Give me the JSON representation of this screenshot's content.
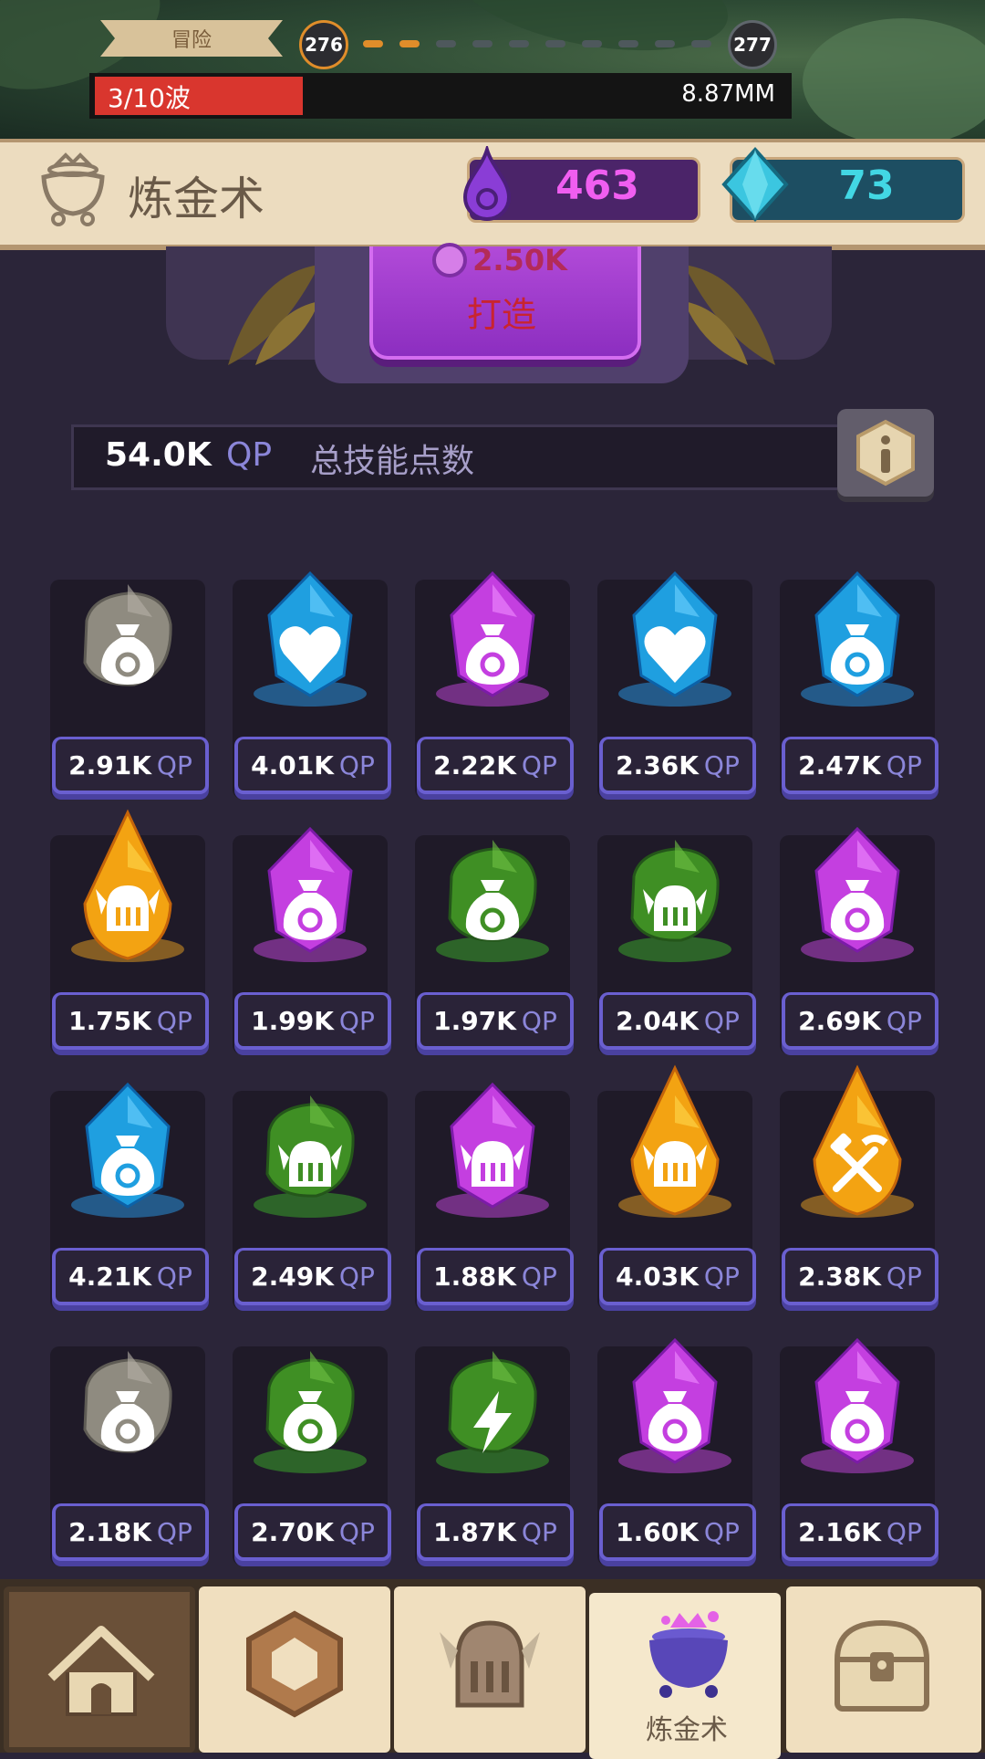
{
  "top": {
    "mode_label": "冒险",
    "level_current": "276",
    "level_next": "277",
    "wave_text": "3/10波",
    "wave_progress": 0.3,
    "damage_text": "8.87MM"
  },
  "header": {
    "title": "炼金术",
    "elixir_value": "463",
    "gem_value": "73",
    "colors": {
      "elixir": "#f05ef0",
      "gem": "#42d7e4"
    }
  },
  "forge": {
    "cost": "2.50K",
    "label": "打造"
  },
  "qp": {
    "value": "54.0K",
    "unit": "QP",
    "label": "总技能点数"
  },
  "grid": [
    {
      "qp": "2.91K",
      "unit": "QP",
      "gem": "grey",
      "icon": "money-bag-icon"
    },
    {
      "qp": "4.01K",
      "unit": "QP",
      "gem": "blue",
      "icon": "heart-icon"
    },
    {
      "qp": "2.22K",
      "unit": "QP",
      "gem": "purple",
      "icon": "money-bag-icon"
    },
    {
      "qp": "2.36K",
      "unit": "QP",
      "gem": "blue",
      "icon": "heart-icon"
    },
    {
      "qp": "2.47K",
      "unit": "QP",
      "gem": "blue",
      "icon": "money-bag-icon"
    },
    {
      "qp": "1.75K",
      "unit": "QP",
      "gem": "gold",
      "icon": "knight-helmet-icon"
    },
    {
      "qp": "1.99K",
      "unit": "QP",
      "gem": "purple",
      "icon": "money-bag-icon"
    },
    {
      "qp": "1.97K",
      "unit": "QP",
      "gem": "green",
      "icon": "money-bag-icon"
    },
    {
      "qp": "2.04K",
      "unit": "QP",
      "gem": "green",
      "icon": "knight-helmet-icon"
    },
    {
      "qp": "2.69K",
      "unit": "QP",
      "gem": "purple",
      "icon": "money-bag-icon"
    },
    {
      "qp": "4.21K",
      "unit": "QP",
      "gem": "blue",
      "icon": "money-bag-icon"
    },
    {
      "qp": "2.49K",
      "unit": "QP",
      "gem": "green",
      "icon": "knight-helmet-icon"
    },
    {
      "qp": "1.88K",
      "unit": "QP",
      "gem": "purple",
      "icon": "knight-helmet-icon"
    },
    {
      "qp": "4.03K",
      "unit": "QP",
      "gem": "gold",
      "icon": "knight-helmet-icon"
    },
    {
      "qp": "2.38K",
      "unit": "QP",
      "gem": "gold",
      "icon": "hammer-pickaxe-icon"
    },
    {
      "qp": "2.18K",
      "unit": "QP",
      "gem": "grey",
      "icon": "money-bag-icon"
    },
    {
      "qp": "2.70K",
      "unit": "QP",
      "gem": "green",
      "icon": "money-bag-icon"
    },
    {
      "qp": "1.87K",
      "unit": "QP",
      "gem": "green",
      "icon": "lightning-icon"
    },
    {
      "qp": "1.60K",
      "unit": "QP",
      "gem": "purple",
      "icon": "money-bag-icon"
    },
    {
      "qp": "2.16K",
      "unit": "QP",
      "gem": "purple",
      "icon": "money-bag-icon"
    }
  ],
  "nav": {
    "items": [
      {
        "name": "home",
        "icon": "hut-icon"
      },
      {
        "name": "rune",
        "icon": "rune-stone-icon"
      },
      {
        "name": "heroes",
        "icon": "knight-helmet-icon"
      },
      {
        "name": "alchemy",
        "icon": "cauldron-icon",
        "label": "炼金术",
        "active": true
      },
      {
        "name": "treasure",
        "icon": "treasure-chest-icon"
      }
    ]
  }
}
